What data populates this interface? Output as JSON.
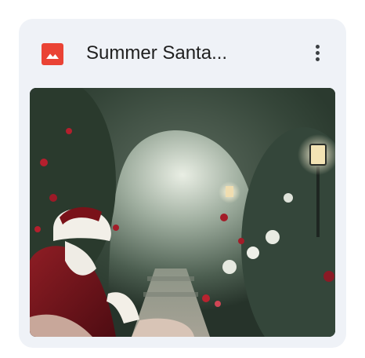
{
  "file": {
    "name": "Summer Santa...",
    "type_icon": "image-file-icon",
    "type_color": "#ea4335"
  },
  "menu": {
    "icon": "more-vert-icon"
  },
  "thumbnail": {
    "subject": "santa-in-garden-image"
  },
  "colors": {
    "card_background": "#eff2f7",
    "title_text": "#1f1f1f",
    "icon_dark": "#3c4043"
  }
}
